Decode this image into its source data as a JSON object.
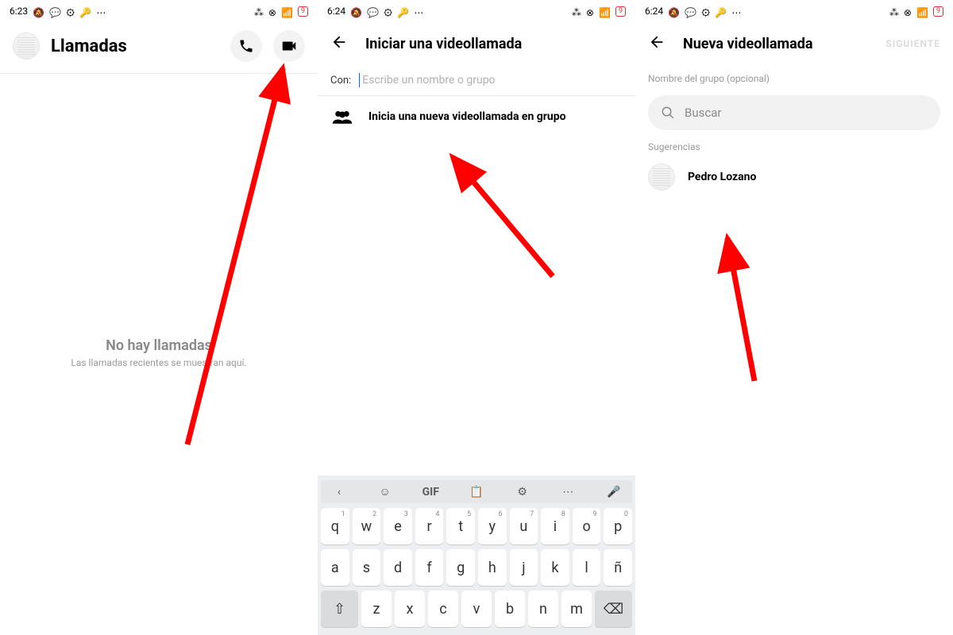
{
  "panel1": {
    "status": {
      "time": "6:23",
      "ico": [
        "🔕",
        "💬",
        "⚙",
        "🔑",
        "⋯"
      ],
      "rico": [
        "⁂",
        "⊗",
        "📶"
      ],
      "batt": "9"
    },
    "title": "Llamadas",
    "empty_title": "No hay llamadas",
    "empty_sub": "Las llamadas recientes se muestran aquí."
  },
  "panel2": {
    "status": {
      "time": "6:24",
      "ico": [
        "🔕",
        "💬",
        "⚙",
        "🔑",
        "⋯"
      ],
      "rico": [
        "⁂",
        "⊗",
        "📶"
      ],
      "batt": "9"
    },
    "title": "Iniciar una videollamada",
    "con_label": "Con:",
    "con_placeholder": "Escribe un nombre o grupo",
    "group_label": "Inicia una nueva videollamada en grupo",
    "keyboard": {
      "top": [
        "‹",
        "☺",
        "GIF",
        "📋",
        "⚙",
        "⋯",
        "🎤"
      ],
      "row1": [
        [
          "q",
          "1"
        ],
        [
          "w",
          "2"
        ],
        [
          "e",
          "3"
        ],
        [
          "r",
          "4"
        ],
        [
          "t",
          "5"
        ],
        [
          "y",
          "6"
        ],
        [
          "u",
          "7"
        ],
        [
          "i",
          "8"
        ],
        [
          "o",
          "9"
        ],
        [
          "p",
          "0"
        ]
      ],
      "row2": [
        "a",
        "s",
        "d",
        "f",
        "g",
        "h",
        "j",
        "k",
        "l",
        "ñ"
      ],
      "row3_shift": "⇧",
      "row3": [
        "z",
        "x",
        "c",
        "v",
        "b",
        "n",
        "m"
      ],
      "row3_back": "⌫"
    }
  },
  "panel3": {
    "status": {
      "time": "6:24",
      "ico": [
        "🔕",
        "💬",
        "⚙",
        "🔑",
        "⋯"
      ],
      "rico": [
        "⁂",
        "⊗",
        "📶"
      ],
      "batt": "9"
    },
    "title": "Nueva videollamada",
    "next": "SIGUIENTE",
    "group_name_label": "Nombre del grupo (opcional)",
    "search_placeholder": "Buscar",
    "sugg_header": "Sugerencias",
    "contact": "Pedro Lozano"
  }
}
